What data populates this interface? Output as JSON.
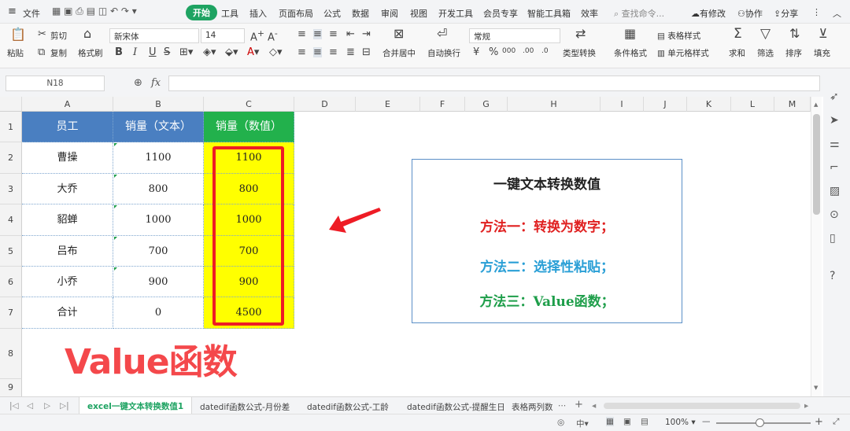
{
  "menu": {
    "file": "文件",
    "tabs": [
      "开始",
      "工具",
      "插入",
      "页面布局",
      "公式",
      "数据",
      "审阅",
      "视图",
      "开发工具",
      "会员专享",
      "智能工具箱",
      "效率"
    ],
    "search_placeholder": "查找命令...",
    "right": [
      "有修改",
      "协作",
      "分享"
    ]
  },
  "ribbon": {
    "paste": "粘贴",
    "cut": "剪切",
    "copy": "复制",
    "format_painter": "格式刷",
    "font_name": "新宋体",
    "font_size": "14",
    "merge_center": "合并居中",
    "wrap": "自动换行",
    "number_format": "常规",
    "type_convert": "类型转换",
    "cond_format": "条件格式",
    "table_style": "表格样式",
    "cell_style": "单元格样式",
    "sum": "求和",
    "filter": "筛选",
    "sort": "排序",
    "fill": "填充",
    "bold": "B",
    "italic": "I",
    "underline": "U",
    "currency": "¥",
    "percent": "%",
    "thousands": "000"
  },
  "formula": {
    "name_box": "N18",
    "fx": "fx",
    "value": ""
  },
  "grid": {
    "columns": [
      "A",
      "B",
      "C",
      "D",
      "E",
      "F",
      "G",
      "H",
      "I",
      "J",
      "K",
      "L",
      "M"
    ],
    "rows": [
      "1",
      "2",
      "3",
      "4",
      "5",
      "6",
      "7",
      "8",
      "9"
    ],
    "headers": [
      "员工",
      "销量（文本）",
      "销量（数值）"
    ],
    "data": [
      [
        "曹操",
        "1100",
        "1100"
      ],
      [
        "大乔",
        "800",
        "800"
      ],
      [
        "貂蝉",
        "1000",
        "1000"
      ],
      [
        "吕布",
        "700",
        "700"
      ],
      [
        "小乔",
        "900",
        "900"
      ],
      [
        "合计",
        "0",
        "4500"
      ]
    ]
  },
  "info": {
    "title": "一键文本转换数值",
    "m1": "方法一：转换为数字；",
    "m2": "方法二：选择性粘贴；",
    "m3": "方法三：Value函数；"
  },
  "overlay_title": "Value函数",
  "sheets": [
    "excel一键文本转换数值1",
    "datedif函数公式-月份差",
    "datedif函数公式-工龄",
    "datedif函数公式-提醒生日",
    "表格两列数"
  ],
  "status": {
    "zoom": "100%"
  },
  "colors": {
    "header_blue": "#4a7fc1",
    "header_green": "#22b14c",
    "highlight": "#ffff00",
    "red": "#ee1c25",
    "m1": "#e02020",
    "m2": "#2a9fd6",
    "m3": "#1e9e4a",
    "active_tab": "#1ea362"
  }
}
